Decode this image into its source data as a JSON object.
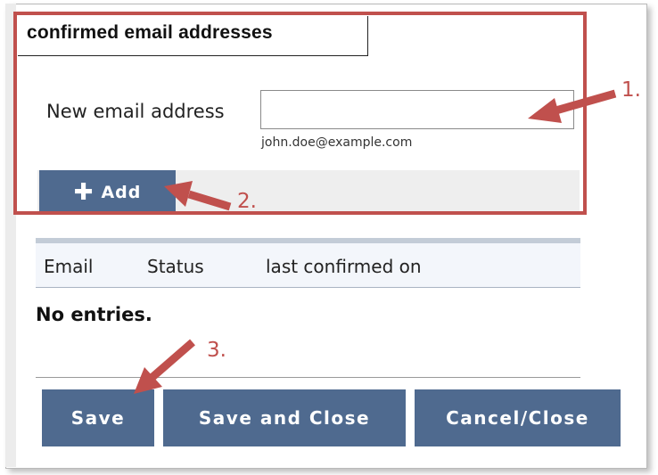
{
  "section": {
    "legend": "confirmed email addresses"
  },
  "form": {
    "new_email_label": "New email address",
    "new_email_value": "",
    "new_email_hint": "john.doe@example.com",
    "add_label": "Add"
  },
  "table": {
    "columns": [
      "Email",
      "Status",
      "last confirmed on"
    ],
    "empty_text": "No entries."
  },
  "actions": {
    "save_label": "Save",
    "save_close_label": "Save and Close",
    "cancel_label": "Cancel/Close"
  },
  "annotations": {
    "step1": "1.",
    "step2": "2.",
    "step3": "3.",
    "color": "#c0504d"
  },
  "colors": {
    "button_bg": "#4f6a8f",
    "button_text": "#ffffff",
    "highlight": "#c0504d",
    "table_header_bg": "#f3f6fb"
  },
  "icons": {
    "add": "plus-icon"
  }
}
